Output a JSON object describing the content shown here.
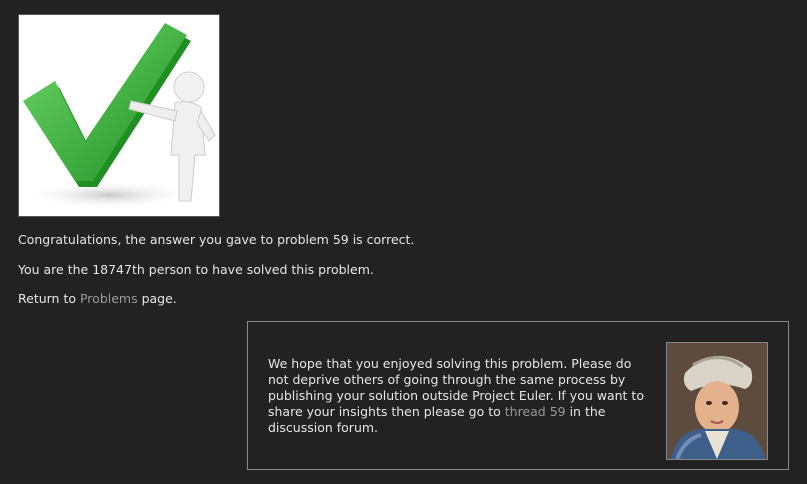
{
  "hero": {
    "image_icon": "green-checkmark-with-figure-icon"
  },
  "messages": {
    "congrats_prefix": "Congratulations, the answer you gave to problem 59 is correct.",
    "solved_count_text": "You are the 18747th person to have solved this problem.",
    "return_prefix": "Return to ",
    "return_link": "Problems",
    "return_suffix": " page."
  },
  "forum": {
    "text_part1": "We hope that you enjoyed solving this problem. Please do not deprive others of going through the same process by publishing your solution outside Project Euler. If you want to share your insights then please go to ",
    "thread_link": "thread 59",
    "text_part2": " in the discussion forum.",
    "portrait_icon": "euler-portrait-icon"
  },
  "colors": {
    "background": "#222222",
    "text": "#e6e6e6",
    "link": "#9a9a9a",
    "check_green": "#3db23d"
  }
}
